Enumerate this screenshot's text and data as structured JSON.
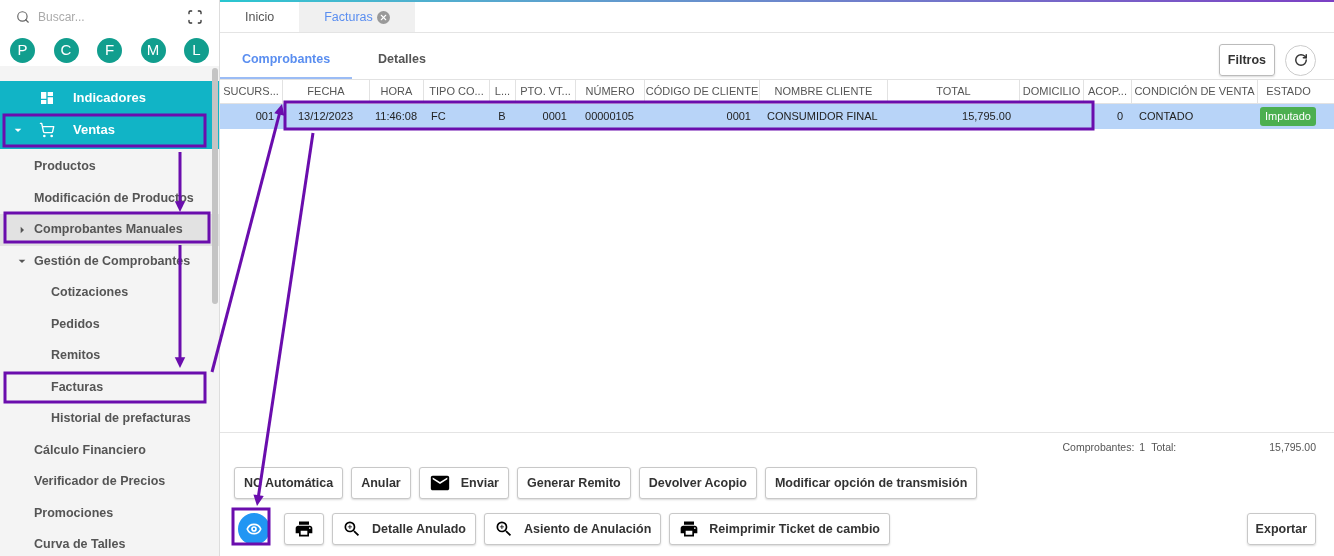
{
  "sidebar": {
    "search": {
      "placeholder": "Buscar..."
    },
    "avatars": [
      "P",
      "C",
      "F",
      "M",
      "L"
    ],
    "menu": [
      {
        "label": "Indicadores",
        "kind": "dashboard"
      },
      {
        "label": "Ventas",
        "kind": "cart",
        "expanded": true,
        "children": [
          {
            "label": "Productos",
            "selected": false
          },
          {
            "label": "Modificación de Productos",
            "selected": false
          },
          {
            "label": "Comprobantes Manuales",
            "expanded": false,
            "selected": true
          },
          {
            "label": "Gestión de Comprobantes",
            "expanded": true,
            "selected": false,
            "children": [
              {
                "label": "Cotizaciones",
                "selected": false
              },
              {
                "label": "Pedidos",
                "selected": false
              },
              {
                "label": "Remitos",
                "selected": false
              },
              {
                "label": "Facturas",
                "selected": false
              },
              {
                "label": "Historial de prefacturas",
                "selected": false
              }
            ]
          },
          {
            "label": "Cálculo Financiero",
            "selected": false
          },
          {
            "label": "Verificador de Precios",
            "selected": false
          },
          {
            "label": "Promociones",
            "selected": false
          },
          {
            "label": "Curva de Talles",
            "selected": false
          }
        ]
      }
    ]
  },
  "tabs": [
    {
      "label": "Inicio",
      "selected": false,
      "closable": false
    },
    {
      "label": "Facturas",
      "selected": true,
      "closable": true
    }
  ],
  "subtabs": [
    {
      "label": "Comprobantes",
      "selected": true
    },
    {
      "label": "Detalles",
      "selected": false
    }
  ],
  "toolbar": {
    "filter_button": "Filtros"
  },
  "table": {
    "columns": [
      "SUCURS...",
      "FECHA",
      "HORA",
      "TIPO CO...",
      "L...",
      "PTO. VT...",
      "NÚMERO",
      "CÓDIGO DE CLIENTE",
      "NOMBRE CLIENTE",
      "TOTAL",
      "DOMICILIO",
      "ACOP...",
      "CONDICIÓN DE VENTA",
      "ESTADO"
    ],
    "rows": [
      {
        "selected": true,
        "cells": [
          "001",
          "13/12/2023",
          "11:46:08",
          "FC",
          "B",
          "0001",
          "00000105",
          "0001",
          "CONSUMIDOR FINAL",
          "15,795.00",
          "",
          "0",
          "CONTADO"
        ],
        "status": {
          "label": "Imputado",
          "color": "#4caf50"
        }
      }
    ]
  },
  "summary": {
    "count_label": "Comprobantes:",
    "count": "1",
    "total_label": "Total:",
    "total": "15,795.00"
  },
  "actions": [
    [
      {
        "label": "NC Automática",
        "kind": "text"
      },
      {
        "label": "Anular",
        "kind": "text"
      },
      {
        "label": "Enviar",
        "kind": "mail"
      },
      {
        "label": "Generar Remito",
        "kind": "text"
      },
      {
        "label": "Devolver Acopio",
        "kind": "text"
      },
      {
        "label": "Modificar opción de transmisión",
        "kind": "text"
      }
    ],
    [
      {
        "kind": "eye"
      },
      {
        "kind": "print"
      },
      {
        "label": "Detalle Anulado",
        "kind": "zoom"
      },
      {
        "label": "Asiento de Anulación",
        "kind": "zoom"
      },
      {
        "label": "Reimprimir Ticket de cambio",
        "kind": "print"
      }
    ]
  ],
  "export_button": "Exportar"
}
